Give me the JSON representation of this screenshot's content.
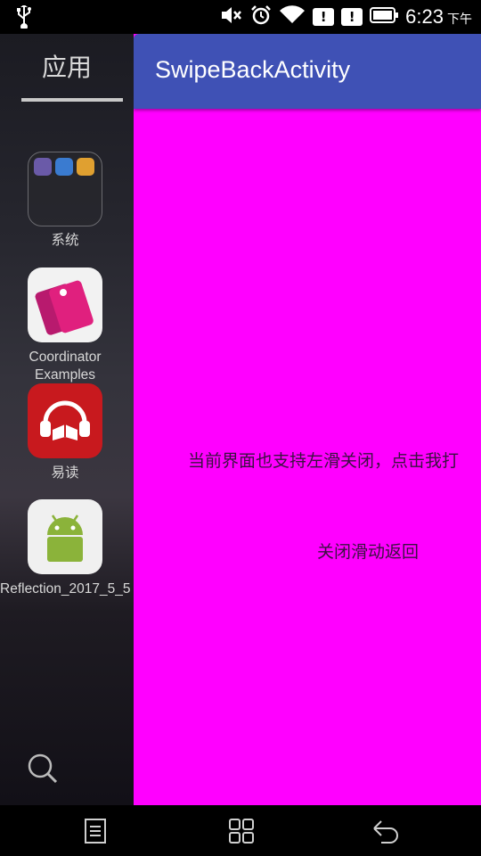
{
  "status_bar": {
    "time": "6:23",
    "ampm": "下午",
    "icons": [
      "usb-icon",
      "mute-icon",
      "alarm-icon",
      "wifi-icon",
      "notification-alert-icon",
      "notification-alert-icon",
      "battery-icon"
    ],
    "alert_glyph": "!"
  },
  "launcher": {
    "header": "应用",
    "apps": [
      {
        "label": "系统",
        "icon": "folder-icon"
      },
      {
        "label": "Coordinator Examples",
        "icon": "coordinator-app-icon"
      },
      {
        "label": "易读",
        "icon": "yidu-app-icon"
      },
      {
        "label": "Reflection_2017_5_5",
        "icon": "android-app-icon"
      }
    ]
  },
  "activity": {
    "title": "SwipeBackActivity",
    "info_text": "当前界面也支持左滑关闭，点击我打",
    "close_swipe_label": "关闭滑动返回",
    "background_color": "#ff00ff",
    "appbar_color": "#3f51b5"
  },
  "nav_bar": {
    "buttons": [
      "menu-icon",
      "home-icon",
      "back-icon"
    ]
  }
}
